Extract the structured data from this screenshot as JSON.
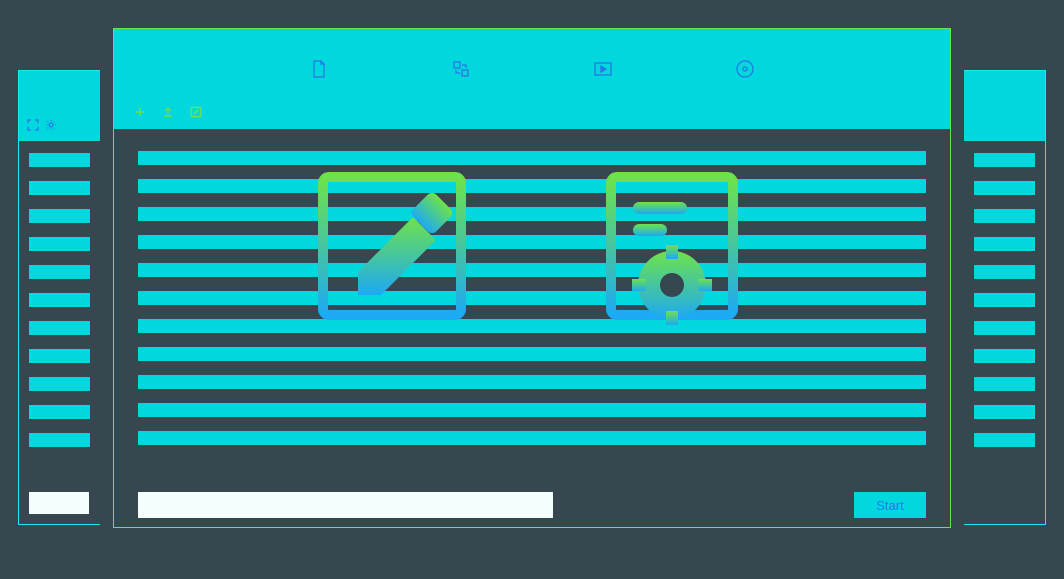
{
  "footer": {
    "start_label": "Start"
  },
  "tabs": {
    "document": "document",
    "convert": "convert",
    "video": "video",
    "disc": "disc"
  },
  "smallbar": {
    "add": "add",
    "upload": "upload",
    "edit": "edit"
  },
  "cards": {
    "edit": "edit-document",
    "settings": "settings-document"
  }
}
